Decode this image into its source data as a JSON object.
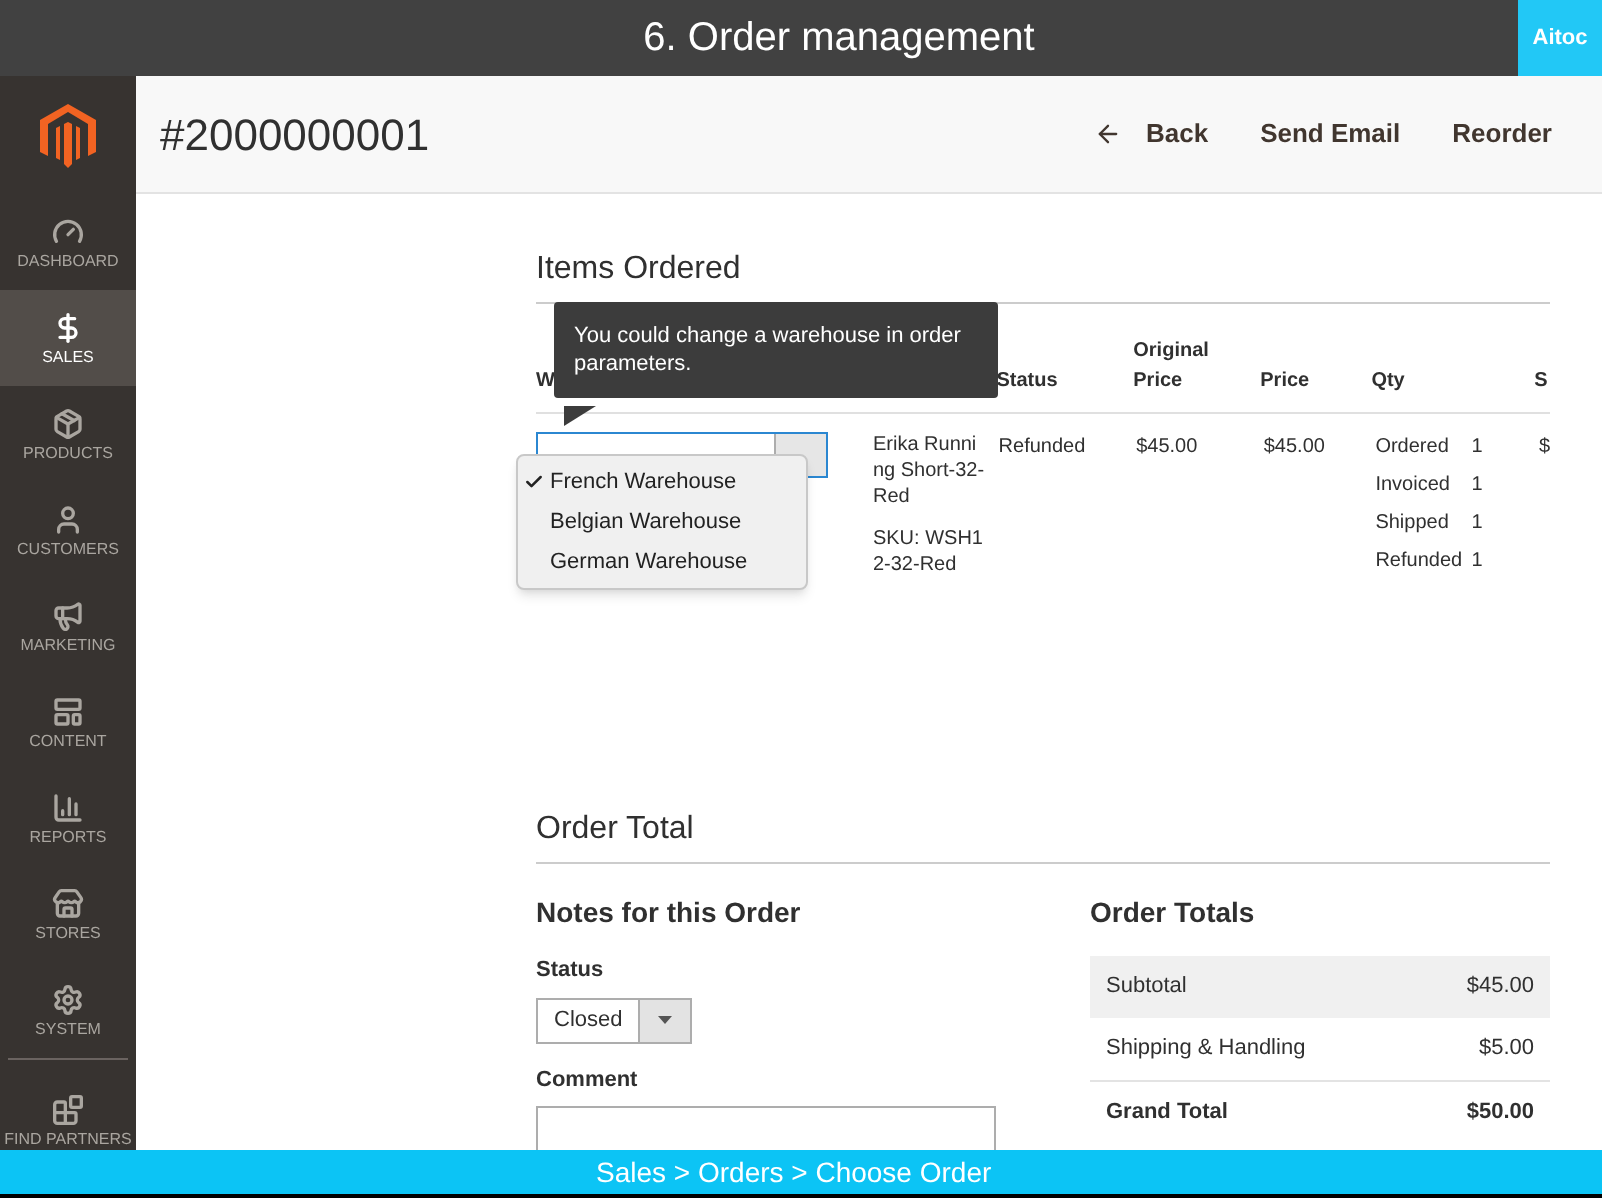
{
  "window": {
    "title": "6. Order management",
    "badge": "Aitoc"
  },
  "sidebar": {
    "items": [
      {
        "label": "DASHBOARD",
        "selected": false
      },
      {
        "label": "SALES",
        "selected": true
      },
      {
        "label": "PRODUCTS",
        "selected": false
      },
      {
        "label": "CUSTOMERS",
        "selected": false
      },
      {
        "label": "MARKETING",
        "selected": false
      },
      {
        "label": "CONTENT",
        "selected": false
      },
      {
        "label": "REPORTS",
        "selected": false
      },
      {
        "label": "STORES",
        "selected": false
      },
      {
        "label": "SYSTEM",
        "selected": false
      },
      {
        "label": "FIND PARTNERS",
        "selected": false
      }
    ]
  },
  "header": {
    "order_number": "#2000000001",
    "actions": [
      {
        "label": "Back",
        "kind": "back"
      },
      {
        "label": "Send Email",
        "kind": "plain"
      },
      {
        "label": "Reorder",
        "kind": "plain"
      }
    ]
  },
  "items_ordered": {
    "title": "Items Ordered",
    "columns": [
      "W",
      "Status",
      "Original Price",
      "Price",
      "Qty",
      "S"
    ],
    "rows": [
      {
        "warehouse_options": [
          {
            "label": "French Warehouse",
            "selected": true
          },
          {
            "label": "Belgian Warehouse",
            "selected": false
          },
          {
            "label": "German Warehouse",
            "selected": false
          }
        ],
        "product": "Erika Running Short-32-Red",
        "sku": "SKU: WSH12-32-Red",
        "item_status": "Refunded",
        "original_price": "$45.00",
        "price": "$45.00",
        "qty": [
          {
            "label": "Ordered",
            "value": "1"
          },
          {
            "label": "Invoiced",
            "value": "1"
          },
          {
            "label": "Shipped",
            "value": "1"
          },
          {
            "label": "Refunded",
            "value": "1"
          }
        ],
        "column_7": "$"
      }
    ],
    "tooltip": "You could change a warehouse in order parameters."
  },
  "order_total": {
    "title": "Order Total",
    "notes": {
      "title": "Notes for this Order",
      "status_label": "Status",
      "status_value": "Closed",
      "comment_label": "Comment"
    },
    "totals": {
      "title": "Order Totals",
      "rows": [
        {
          "label": "Subtotal",
          "value": "$45.00",
          "kind": "shaded"
        },
        {
          "label": "Shipping & Handling",
          "value": "$5.00",
          "kind": "plain"
        },
        {
          "label": "Grand Total",
          "value": "$50.00",
          "kind": "grand"
        }
      ]
    }
  },
  "footer": {
    "breadcrumb": "Sales > Orders > Choose Order"
  }
}
